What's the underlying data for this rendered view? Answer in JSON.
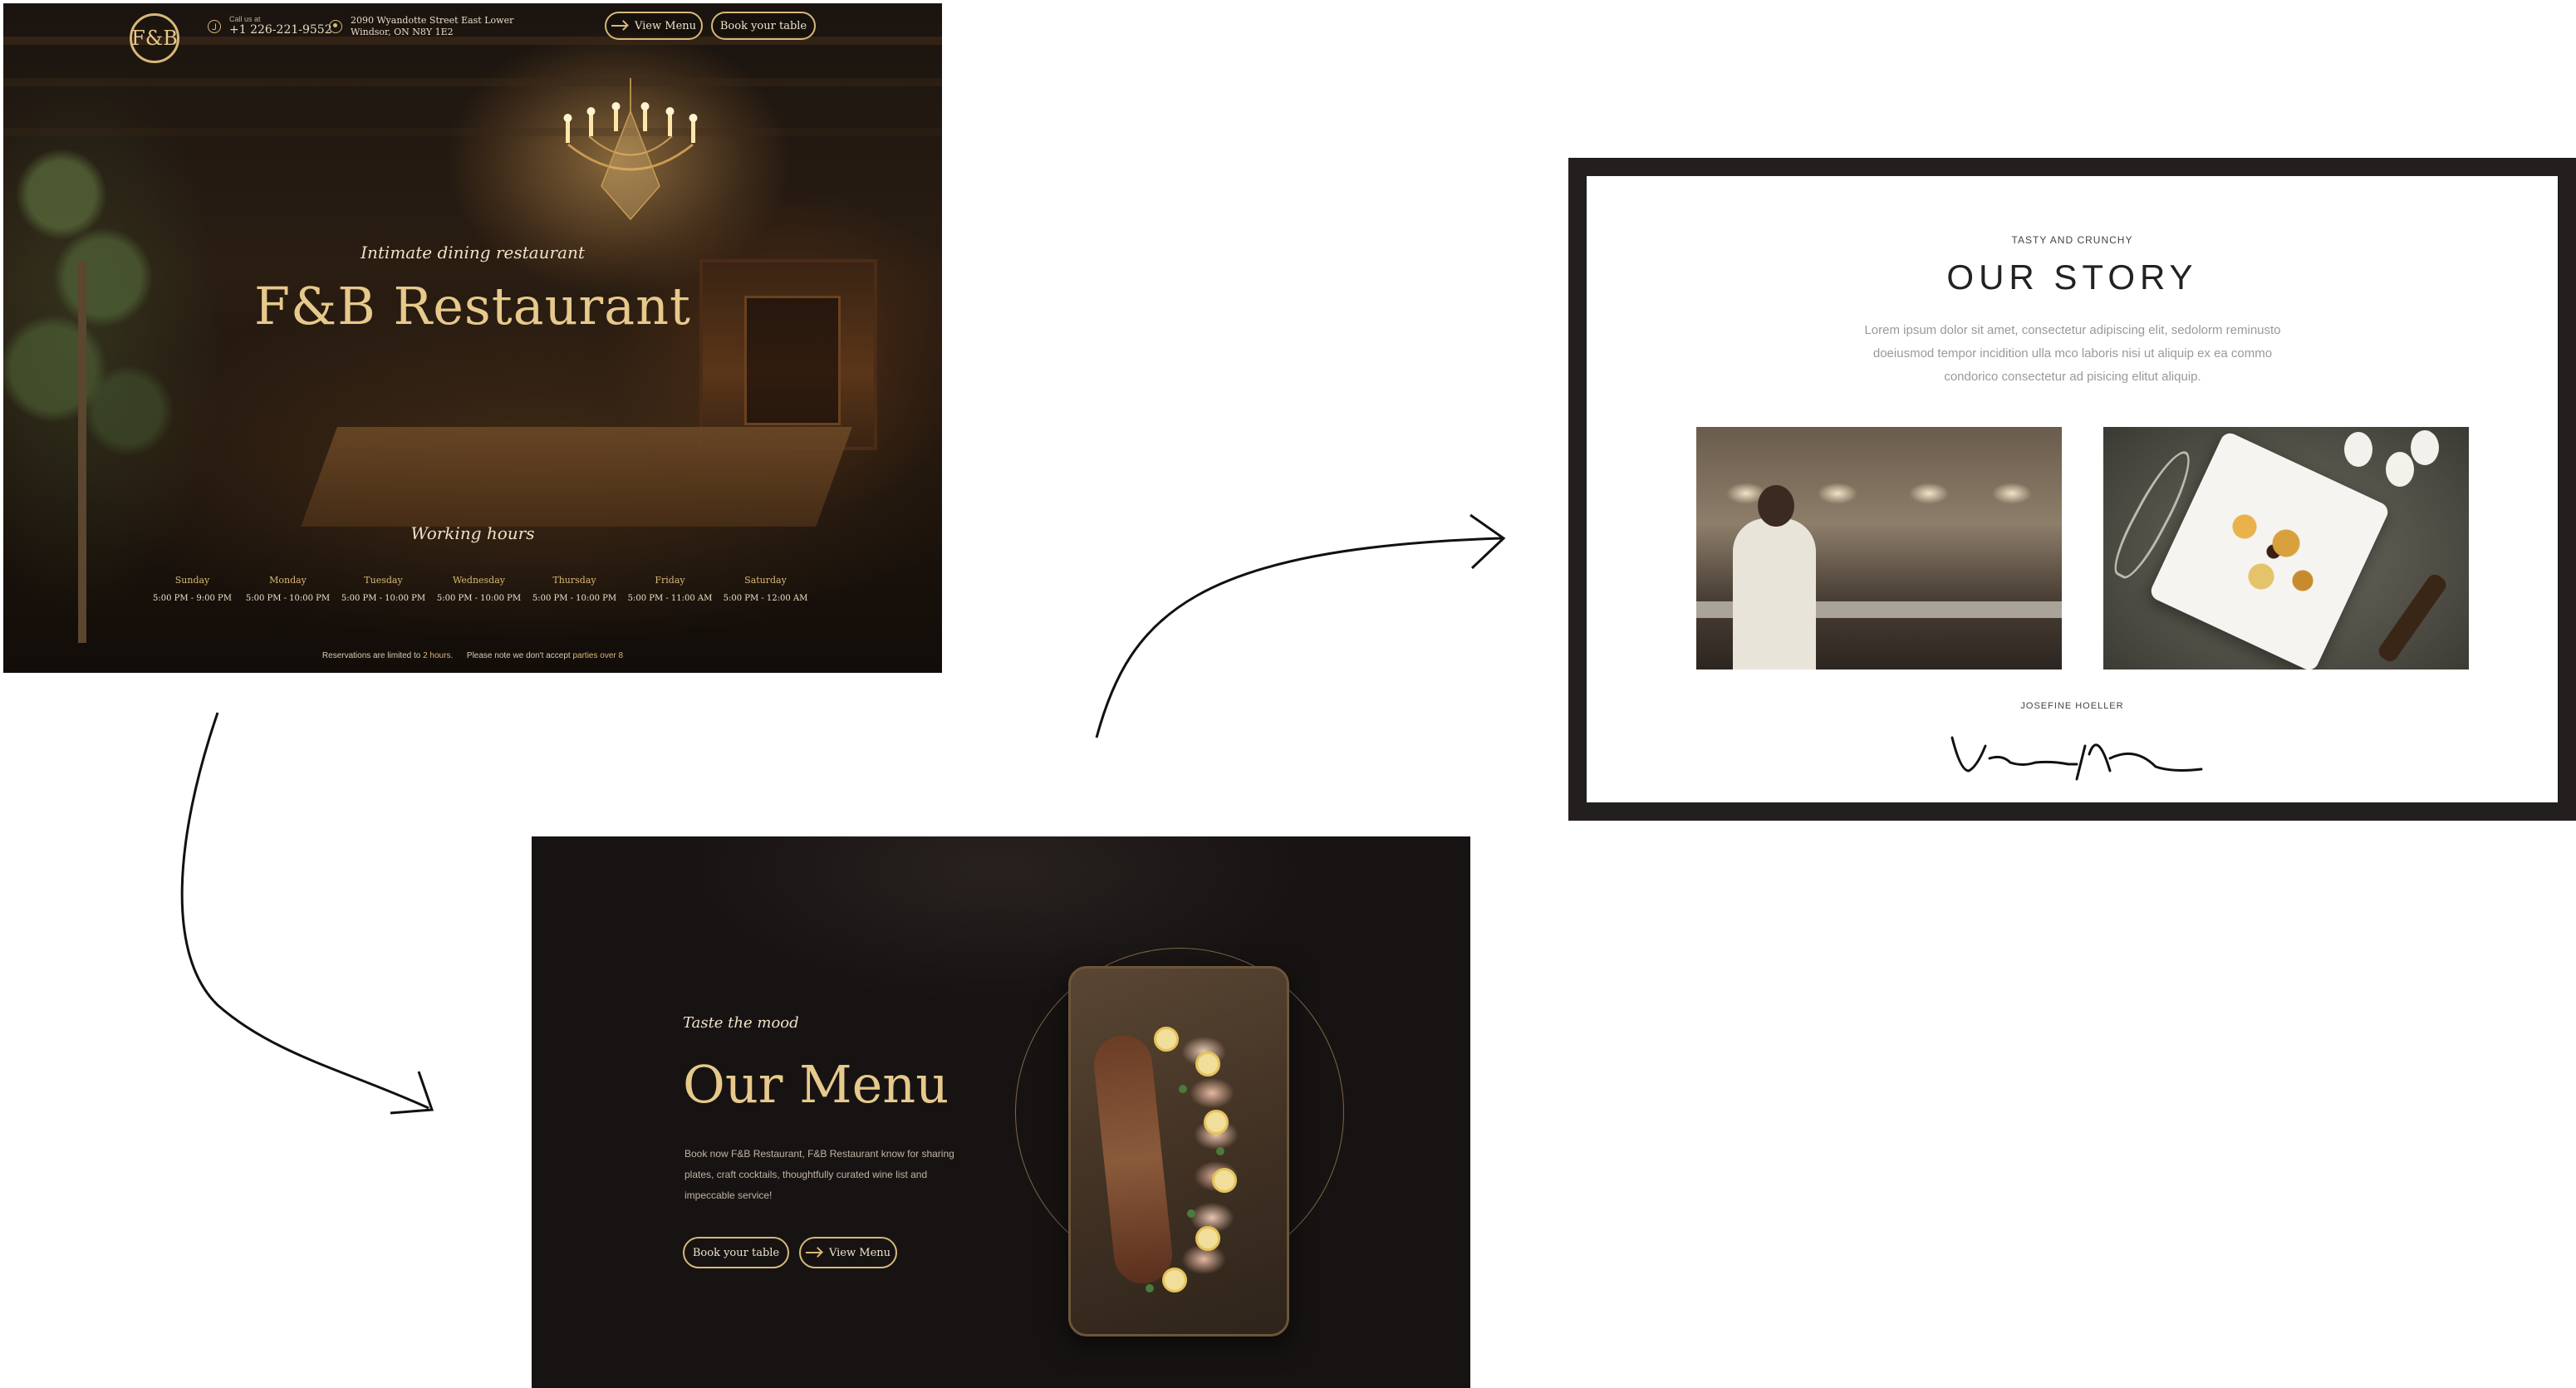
{
  "hero": {
    "logo": "F&B",
    "phone_label": "Call us at",
    "phone": "+1 226-221-9552",
    "address_line1": "2090 Wyandotte Street East Lower",
    "address_line2": "Windsor, ON N8Y 1E2",
    "view_menu_label": "View Menu",
    "book_table_label": "Book your table",
    "tagline": "Intimate dining restaurant",
    "title": "F&B Restaurant",
    "hours_title": "Working hours",
    "hours": [
      {
        "day": "Sunday",
        "time": "5:00 PM - 9:00 PM"
      },
      {
        "day": "Monday",
        "time": "5:00 PM - 10:00 PM"
      },
      {
        "day": "Tuesday",
        "time": "5:00 PM - 10:00 PM"
      },
      {
        "day": "Wednesday",
        "time": "5:00 PM - 10:00 PM"
      },
      {
        "day": "Thursday",
        "time": "5:00 PM - 10:00 PM"
      },
      {
        "day": "Friday",
        "time": "5:00 PM - 11:00 AM"
      },
      {
        "day": "Saturday",
        "time": "5:00 PM - 12:00 AM"
      }
    ],
    "note_prefix": "Reservations are limited to",
    "note_hours": "2 hours.",
    "note_middle": "Please note we don't accept",
    "note_parties": "parties over 8"
  },
  "story": {
    "eyebrow": "TASTY AND CRUNCHY",
    "title": "OUR STORY",
    "body": "Lorem ipsum dolor sit amet, consectetur adipiscing elit, sedolorm reminusto doeiusmod tempor incidition ulla mco laboris nisi ut aliquip ex ea commo condorico consectetur ad pisicing elitut aliquip.",
    "signature_name": "JOSEFINE HOELLER"
  },
  "menu": {
    "tagline": "Taste the mood",
    "title": "Our Menu",
    "body": "Book now F&B Restaurant, F&B Restaurant know for sharing plates, craft cocktails, thoughtfully curated wine list and impeccable service!",
    "book_table_label": "Book your table",
    "view_menu_label": "View Menu"
  },
  "colors": {
    "gold": "#d8b878",
    "title_gold": "#e7c98b",
    "dark_bg": "#171313",
    "frame": "#231f1f"
  }
}
